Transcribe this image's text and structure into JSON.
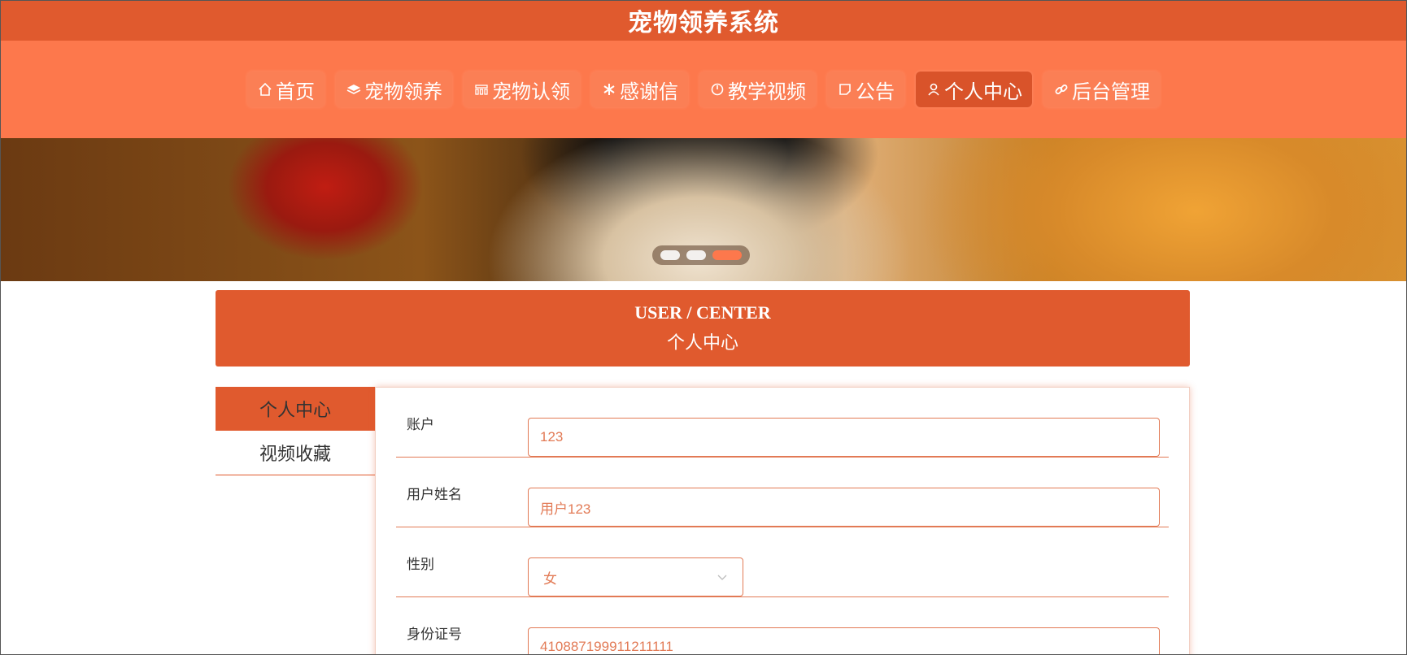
{
  "header": {
    "title": "宠物领养系统"
  },
  "nav": {
    "items": [
      {
        "label": "首页",
        "icon": "home-icon"
      },
      {
        "label": "宠物领养",
        "icon": "layers-icon"
      },
      {
        "label": "宠物认领",
        "icon": "grid-icon"
      },
      {
        "label": "感谢信",
        "icon": "snowflake-icon"
      },
      {
        "label": "教学视频",
        "icon": "clock-icon"
      },
      {
        "label": "公告",
        "icon": "note-icon"
      },
      {
        "label": "个人中心",
        "icon": "user-icon",
        "active": true
      },
      {
        "label": "后台管理",
        "icon": "link-icon"
      }
    ]
  },
  "banner": {
    "slide_count": 3,
    "active_slide": 3
  },
  "section": {
    "title_en": "USER / CENTER",
    "title_cn": "个人中心"
  },
  "sidebar": {
    "items": [
      {
        "label": "个人中心",
        "active": true
      },
      {
        "label": "视频收藏",
        "active": false
      }
    ]
  },
  "form": {
    "account": {
      "label": "账户",
      "value": "123"
    },
    "username": {
      "label": "用户姓名",
      "value": "用户123"
    },
    "gender": {
      "label": "性别",
      "value": "女"
    },
    "id_number": {
      "label": "身份证号",
      "value": "410887199911211111"
    }
  },
  "colors": {
    "primary": "#e05a2e",
    "nav_bg": "#fd784c",
    "input_accent": "#e27a55"
  }
}
